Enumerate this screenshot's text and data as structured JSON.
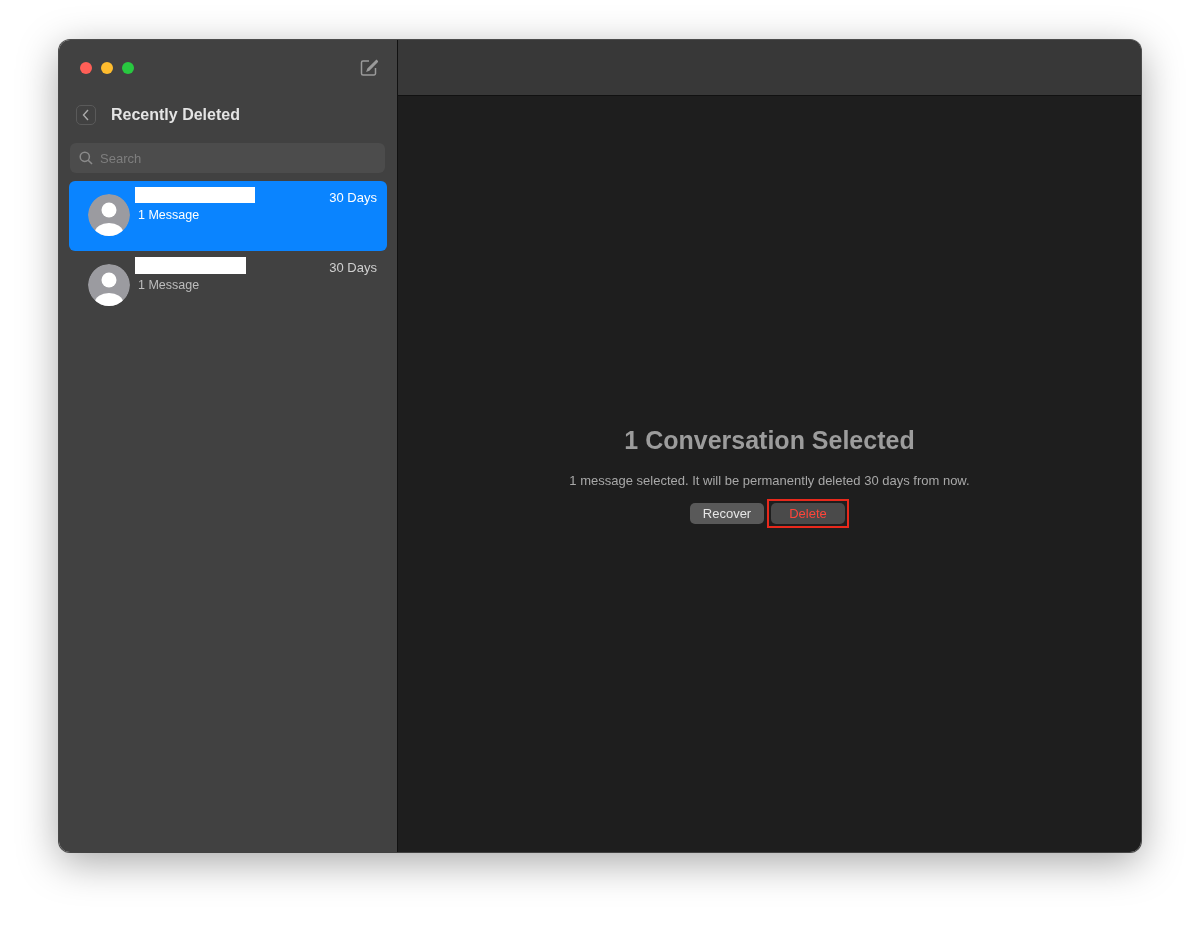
{
  "sidebar": {
    "title": "Recently Deleted",
    "search": {
      "placeholder": "Search"
    },
    "conversations": [
      {
        "name_hidden": true,
        "age": "30 Days",
        "count": "1 Message",
        "selected": true
      },
      {
        "name_hidden": true,
        "age": "30 Days",
        "count": "1 Message",
        "selected": false
      }
    ]
  },
  "detail": {
    "heading": "1 Conversation Selected",
    "message": "1 message selected. It will be permanently deleted 30 days from now.",
    "buttons": [
      {
        "label": "Recover",
        "kind": "recover",
        "highlighted": false
      },
      {
        "label": "Delete",
        "kind": "delete",
        "highlighted": true
      }
    ]
  }
}
